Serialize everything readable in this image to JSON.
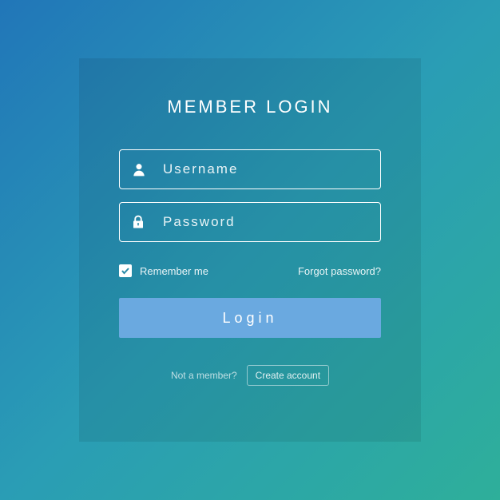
{
  "title": "MEMBER LOGIN",
  "username": {
    "placeholder": "Username",
    "value": ""
  },
  "password": {
    "placeholder": "Password",
    "value": ""
  },
  "remember": {
    "label": "Remember me",
    "checked": true
  },
  "forgot": "Forgot password?",
  "login_button": "Login",
  "signup": {
    "prompt": "Not a member?",
    "action": "Create account"
  }
}
